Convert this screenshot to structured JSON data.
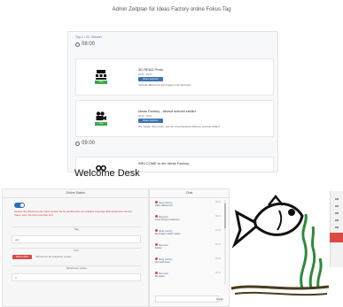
{
  "page_title": "Admin Zeitplan für Ideas Factory online Fokus-Tag",
  "schedule": {
    "breadcrumb": "Tag 1 • 22. Oktober",
    "times": [
      "08:00",
      "09:00"
    ],
    "cards": [
      {
        "title": "3D READ Proto",
        "meta": "08:00 - 08:30",
        "button": "Raum betreten",
        "desc": "Virtuelle Bühne für alle Fragen und Wünsche",
        "tag": "Live",
        "icon": "theater-icon"
      },
      {
        "title": "Ideas Factory - Ablauf schnell erklärt",
        "meta": "08:30 - 09:00",
        "button": "Raum betreten",
        "desc": "Wir zeigen Ihnen kurz, wie die verschiedenen Räume und das Ablauf",
        "tag": "Live",
        "icon": "video-camera-icon"
      },
      {
        "title": "WELCOME in der Ideas Factory",
        "icon": "infinity-icon"
      }
    ]
  },
  "welcome_desk": "Welcome Desk",
  "status_panel": {
    "header": "Online Status",
    "warning": "Hinweis: Bei Aktivierung des Status werden Sie für alle Besucher als verfügbar angezeigt. Bitte deaktivieren Sie den Status, wenn Sie nicht erreichbar sind.",
    "section_tag": "Tag",
    "field_value": "alle",
    "section_info": "Info",
    "red_button": "Status offline",
    "red_text": "Nachricht an alle Teilnehmer senden",
    "section_entries": "Teilnehmer online",
    "entries_value": "3"
  },
  "chat_panel": {
    "header": "Chat",
    "messages": [
      {
        "name": "Ideas Factory",
        "text": "Hallo, willkommen!",
        "time": "08:02"
      },
      {
        "name": "Besucher",
        "text": "Guten Morgen zusammen",
        "time": "08:04"
      },
      {
        "name": "Ideas Factory",
        "text": "Bei Fragen einfach melden.",
        "time": "08:05"
      },
      {
        "name": "Besucher",
        "text": "Danke!",
        "time": "08:07"
      },
      {
        "name": "Ideas Factory",
        "text": "Viel Spaß heute",
        "time": "08:09"
      },
      {
        "name": "Besucher",
        "text": "Bis später",
        "time": "08:11"
      }
    ],
    "send": "Senden"
  },
  "colors": {
    "accent_blue": "#3a73b5",
    "live_green": "#3aa84a",
    "alert_red": "#d94a45"
  }
}
